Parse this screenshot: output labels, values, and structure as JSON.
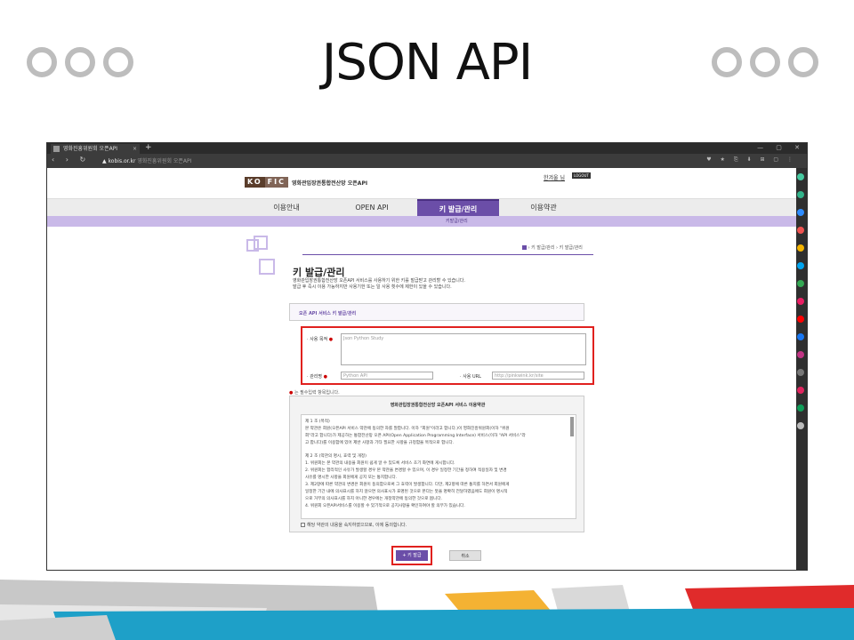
{
  "slide": {
    "title": "JSON API"
  },
  "browser": {
    "tab_title": "영화진흥위원회 오픈API",
    "tab_close": "×",
    "new_tab": "+",
    "window_controls": "— ▢ ✕",
    "nav_buttons": "‹ › ↻",
    "url_domain": "kobis.or.kr",
    "url_rest": "영화진흥위원회 오픈API",
    "extensions": "♥ ★ ⎘ ⬇ ⊞ ▢ ⋮"
  },
  "site": {
    "logo_ko": "KO",
    "logo_fic": "FIC",
    "logo_text": "영화관입장권통합전산망 오픈API",
    "user_link": "한겨울 님",
    "logout": "LOGOUT",
    "nav": [
      {
        "label": "이용안내"
      },
      {
        "label": "OPEN API"
      },
      {
        "label": "키 발급/관리"
      },
      {
        "label": "이용약관"
      }
    ],
    "subnav_label": "키발급/관리",
    "breadcrumb": "› 키 발급/관리 › 키 발급/관리"
  },
  "main": {
    "title": "키 발급/관리",
    "desc_line1": "영화관입장권통합전산망 오픈API 서비스를 사용하기 위한 키를 발급받고 관리할 수 있습니다.",
    "desc_line2": "발급 후 즉시 이용 가능하지만 사용기한 또는 일 사용 횟수에 제한이 있을 수 있습니다.",
    "form_header": "오픈 API 서비스 키 발급/관리",
    "purpose_label": "사용 목적",
    "purpose_value": "Json Python Study",
    "manager_label": "관리명",
    "manager_value": "Python API",
    "url_label": "사용 URL",
    "url_value": "http://pinkwink.kr/site",
    "required_note": "는 필수입력 항목입니다.",
    "required_star": "●"
  },
  "terms": {
    "title": "영화관입장권통합전산망 오픈API 서비스 이용약관",
    "lines": [
      "제 1 조 (목적)",
      "본 약관은 회원(오픈API 서비스 약관에 동의한 자를 말합니다. 이하 \"회원\"이라고 합니다.)이 영화진흥위원회(이하 \"위원",
      "회\"라고 합니다)가 제공하는 통합전산망 오픈 API(Open Application Programming Interface) 서비스(이하 \"API 서비스\"라",
      "고 합니다)를 이용함에 있어 제반 사항과 기타 필요한 사항을 규정함을 목적으로 합니다.",
      "",
      "제 2 조 (약관의 명시, 효력 및 개정)",
      "1. 위원회는 본 약관의 내용을 회원이 쉽게 알 수 있도록 서비스 초기 화면에 게시합니다.",
      "2. 위원회는 합리적인 사유가 발생할 경우 본 약관을 변경할 수 있으며, 이 경우 일정한 기간을 정하여 적용일자 및 변경",
      "사유를 명시한 사항을 회원에게 공지 또는 통지합니다.",
      "3. 제2항에 따른 약관의 변경은 회원이 동의함으로써 그 효력이 발생합니다. 다만, 제2항에 따른 통지를 하면서 회원에게",
      "일정한 기간 내에 의사표시를 하지 않으면 의사표시가 표명된 것으로 본다는 뜻을 명확히 전달하였음에도 회원이 명시적",
      "으로 거부의 의사표시를 하지 아니한 경우에는 개정약관에 동의한 것으로 봅니다.",
      "4. 위원회 오픈API서비스를 이용할 수 있기적으로 공지사항을 확인하여야 할 의무가 있습니다."
    ],
    "agree_label": "해당 약관의 내용을 숙지하였으므로, 이에 동의합니다."
  },
  "buttons": {
    "issue": "+ 키 발급",
    "cancel": "취소"
  },
  "colors": {
    "accent": "#6b4ea8",
    "highlight": "#e0211e"
  }
}
